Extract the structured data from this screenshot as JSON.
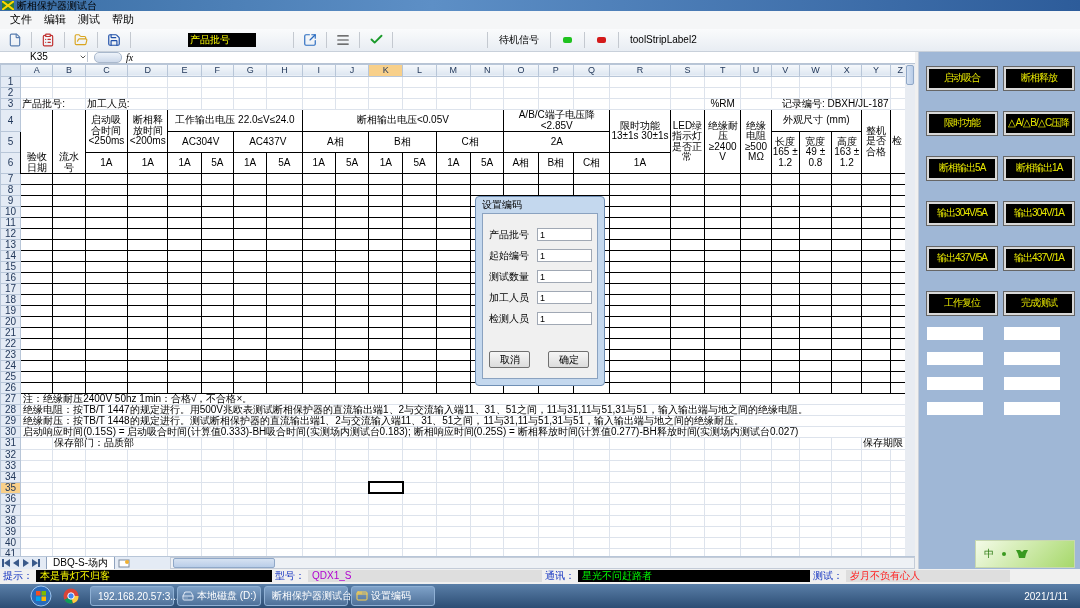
{
  "window": {
    "title": "断相保护器测试台"
  },
  "menu": [
    {
      "label": "文件"
    },
    {
      "label": "编辑"
    },
    {
      "label": "测试"
    },
    {
      "label": "帮助"
    }
  ],
  "toolbar": {
    "batch_field": "产品批号",
    "standby_label": "待机信号",
    "indicators": [
      {
        "color": "#1fc21f"
      },
      {
        "color": "#d41a1a"
      }
    ],
    "status_label": "toolStripLabel2"
  },
  "formula_bar": {
    "name_box": "K35",
    "fx": "fx"
  },
  "sheet": {
    "columns": [
      {
        "label": "A",
        "selected": false
      },
      {
        "label": "B",
        "selected": false
      },
      {
        "label": "C",
        "selected": false
      },
      {
        "label": "D",
        "selected": false
      },
      {
        "label": "E",
        "selected": false
      },
      {
        "label": "F",
        "selected": false
      },
      {
        "label": "G",
        "selected": false
      },
      {
        "label": "H",
        "selected": false
      },
      {
        "label": "I",
        "selected": false
      },
      {
        "label": "J",
        "selected": false
      },
      {
        "label": "K",
        "selected": true
      },
      {
        "label": "L",
        "selected": false
      },
      {
        "label": "M",
        "selected": false
      },
      {
        "label": "N",
        "selected": false
      },
      {
        "label": "O",
        "selected": false
      },
      {
        "label": "P",
        "selected": false
      },
      {
        "label": "Q",
        "selected": false
      },
      {
        "label": "R",
        "selected": false
      },
      {
        "label": "S",
        "selected": false
      },
      {
        "label": "T",
        "selected": false
      },
      {
        "label": "U",
        "selected": false
      },
      {
        "label": "V",
        "selected": false
      },
      {
        "label": "W",
        "selected": false
      },
      {
        "label": "X",
        "selected": false
      },
      {
        "label": "Y",
        "selected": false
      },
      {
        "label": "Z",
        "selected": false
      }
    ],
    "rows": [
      {
        "label": "1",
        "selected": false
      },
      {
        "label": "2",
        "selected": false
      },
      {
        "label": "3",
        "selected": false
      },
      {
        "label": "4",
        "selected": false
      },
      {
        "label": "5",
        "selected": false
      },
      {
        "label": "6",
        "selected": false
      },
      {
        "label": "7",
        "selected": false
      },
      {
        "label": "8",
        "selected": false
      },
      {
        "label": "9",
        "selected": false
      },
      {
        "label": "10",
        "selected": false
      },
      {
        "label": "11",
        "selected": false
      },
      {
        "label": "12",
        "selected": false
      },
      {
        "label": "13",
        "selected": false
      },
      {
        "label": "14",
        "selected": false
      },
      {
        "label": "15",
        "selected": false
      },
      {
        "label": "16",
        "selected": false
      },
      {
        "label": "17",
        "selected": false
      },
      {
        "label": "18",
        "selected": false
      },
      {
        "label": "19",
        "selected": false
      },
      {
        "label": "20",
        "selected": false
      },
      {
        "label": "21",
        "selected": false
      },
      {
        "label": "22",
        "selected": false
      },
      {
        "label": "23",
        "selected": false
      },
      {
        "label": "24",
        "selected": false
      },
      {
        "label": "25",
        "selected": false
      },
      {
        "label": "26",
        "selected": false
      },
      {
        "label": "27",
        "selected": false
      },
      {
        "label": "28",
        "selected": false
      },
      {
        "label": "29",
        "selected": false
      },
      {
        "label": "30",
        "selected": false
      },
      {
        "label": "31",
        "selected": false
      },
      {
        "label": "32",
        "selected": false
      },
      {
        "label": "33",
        "selected": false
      },
      {
        "label": "34",
        "selected": false
      },
      {
        "label": "35",
        "selected": true
      },
      {
        "label": "36",
        "selected": false
      },
      {
        "label": "37",
        "selected": false
      },
      {
        "label": "38",
        "selected": false
      },
      {
        "label": "39",
        "selected": false
      },
      {
        "label": "40",
        "selected": false
      },
      {
        "label": "41",
        "selected": false
      }
    ],
    "texts": [
      "产品批号:",
      "加工人员:",
      "%RM",
      "记录编号: DBXH/JL-187",
      "验收日期",
      "流水号",
      "启动吸合时间<250ms",
      "断相释放时间<200ms",
      "工作输出电压  22.0≤V≤24.0",
      "断相输出电压<0.05V",
      "A/B/C端子电压降<2.85V",
      "限时功能\n13±1s  30±1s",
      "LED绿指示灯是否正常",
      "绝缘耐压≥2400V",
      "绝缘电阻≥500MΩ",
      "外观尺寸 (mm)",
      "整机是否合格",
      "检",
      "AC304V",
      "AC437V",
      "A相",
      "B相",
      "C相",
      "2A",
      "长度165 ± 1.2",
      "宽度 49 ± 0.8",
      "高度163 ± 1.2",
      "1A",
      "1A",
      "1A",
      "5A",
      "1A",
      "5A",
      "1A",
      "5A",
      "1A",
      "5A",
      "1A",
      "5A",
      "A相",
      "B相",
      "C相",
      "1A",
      "注：绝缘耐压2400V 50hz 1min：合格√，不合格×。",
      "绝缘电阻：按TB/T 1447的规定进行。用500V兆欧表测试断相保护器的直流输出端1、2与交流输入端11、31、51之间，11与31,11与51,31与51，输入输出端与地之间的绝缘电阻。",
      "绝缘耐压：按TB/T 1448的规定进行。测试断相保护器的直流输出端1、2与交流输入端11、31、51之间，11与31,11与51,31与51，输入输出端与地之间的绝缘耐压。",
      "启动响应时间(0.15S) = 启动吸合时间(计算值0.333)-BH吸合时间(实测场内测试台0.183); 断相响应时间(0.25S) = 断相释放时间(计算值0.277)-BH释放时间(实测场内测试台0.027)",
      "保存部门：品质部",
      "保存期限"
    ]
  },
  "sheet_tabs": [
    {
      "label": "DBQ-S-场内",
      "selected": true
    }
  ],
  "dialog": {
    "title": "设置编码",
    "fields": [
      {
        "label": "产品批号",
        "value": "1"
      },
      {
        "label": "起始编号",
        "value": "1"
      },
      {
        "label": "测试数量",
        "value": "1"
      },
      {
        "label": "加工人员",
        "value": "1"
      },
      {
        "label": "检测人员",
        "value": "1"
      }
    ],
    "buttons": [
      "取消",
      "确定"
    ]
  },
  "side_panel": {
    "buttons": [
      "启动吸合",
      "断相释放",
      "限时功能",
      "△A/△B/△C压降",
      "断相输出5A",
      "断相输出1A",
      "输出304V/5A",
      "输出304V/1A",
      "输出437V/5A",
      "输出437V/1A",
      "工作复位",
      "完成测试"
    ]
  },
  "ime_bar": {
    "label": "中"
  },
  "status_bar": [
    {
      "label": "提示：",
      "value": "本是青灯不归客",
      "kind": "hint"
    },
    {
      "label": "型号：",
      "value": "QDX1_S",
      "kind": "model"
    },
    {
      "label": "通讯：",
      "value": "星光不问赶路者",
      "kind": "comm"
    },
    {
      "label": "测试：",
      "value": "岁月不负有心人",
      "kind": "test"
    }
  ],
  "taskbar": {
    "items": [
      {
        "label": "192.168.20.57:3..."
      },
      {
        "label": "本地磁盘 (D:)"
      },
      {
        "label": "断相保护器测试台"
      },
      {
        "label": "设置编码"
      }
    ],
    "date": "2021/1/11"
  }
}
